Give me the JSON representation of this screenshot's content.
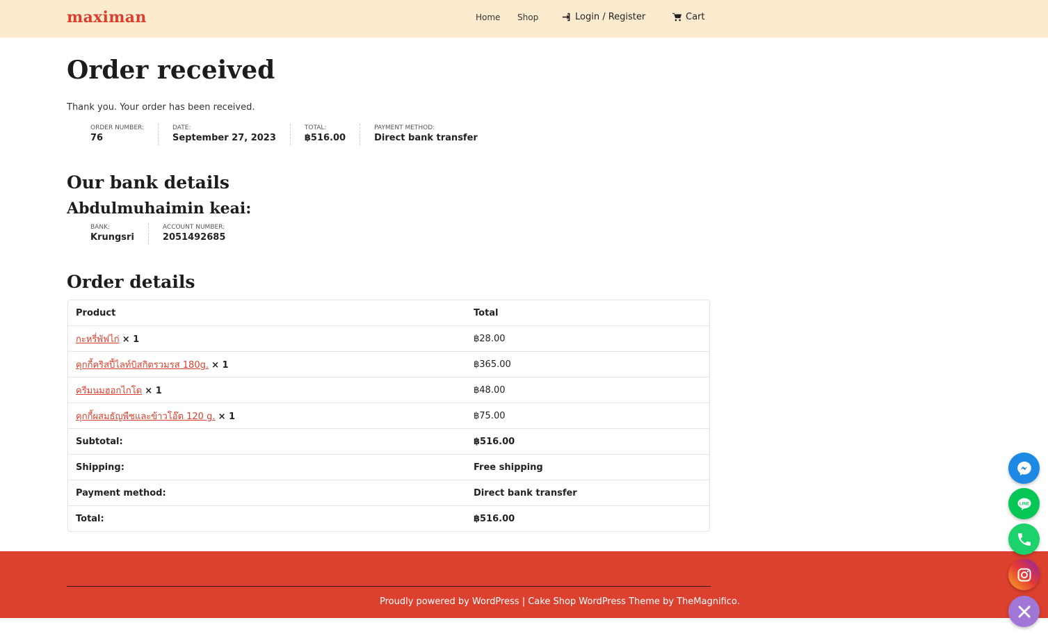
{
  "header": {
    "logo": "maximan",
    "nav": {
      "home": "Home",
      "shop": "Shop",
      "login": "Login / Register",
      "cart": "Cart"
    }
  },
  "page": {
    "title": "Order received",
    "thanks": "Thank you. Your order has been received."
  },
  "overview": {
    "order_number_label": "ORDER NUMBER:",
    "order_number": "76",
    "date_label": "DATE:",
    "date": "September 27, 2023",
    "total_label": "TOTAL:",
    "total": "฿516.00",
    "payment_label": "PAYMENT METHOD:",
    "payment": "Direct bank transfer"
  },
  "bank_details": {
    "heading": "Our bank details",
    "account_name": "Abdulmuhaimin keai:",
    "bank_label": "BANK:",
    "bank": "Krungsri",
    "account_number_label": "ACCOUNT NUMBER:",
    "account_number": "2051492685"
  },
  "order_details": {
    "heading": "Order details",
    "col_product": "Product",
    "col_total": "Total",
    "items": [
      {
        "name": "กะหรี่พัฟไก่",
        "qty": "× 1",
        "total": "฿28.00"
      },
      {
        "name": "คุกกี้คริสปี้ไลท์บิสกิตรวมรส 180g.",
        "qty": "× 1",
        "total": "฿365.00"
      },
      {
        "name": "ครีมนมฮอกไกโด",
        "qty": "× 1",
        "total": "฿48.00"
      },
      {
        "name": "คุกกี้ผสมธัญพืชและข้าวโอ๊ต 120 g.",
        "qty": "× 1",
        "total": "฿75.00"
      }
    ],
    "subtotal_label": "Subtotal:",
    "subtotal": "฿516.00",
    "shipping_label": "Shipping:",
    "shipping": "Free shipping",
    "payment_label": "Payment method:",
    "payment": "Direct bank transfer",
    "total_label": "Total:",
    "total": "฿516.00"
  },
  "footer": {
    "powered": "Proudly powered by WordPress",
    "sep": "|",
    "theme": "Cake Shop WordPress Theme by TheMagnifico."
  },
  "colors": {
    "brand": "#d93f2d",
    "header_bg": "#fdebd0",
    "footer_bg": "#dc402e",
    "messenger": "#1e88e5",
    "line": "#06c755",
    "phone": "#1bd36a",
    "close": "#a077d6"
  },
  "floating_buttons": [
    "messenger-icon",
    "line-icon",
    "phone-icon",
    "instagram-icon",
    "close-icon"
  ]
}
